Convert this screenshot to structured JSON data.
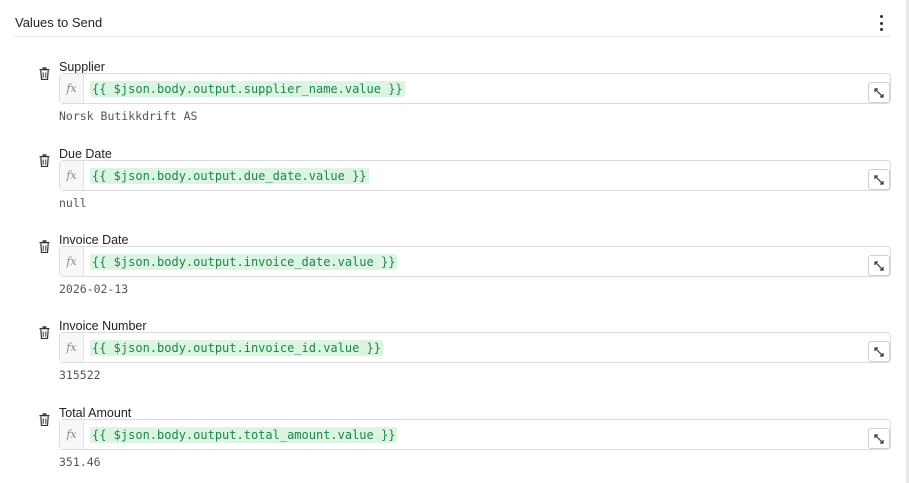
{
  "section": {
    "title": "Values to Send",
    "menu_icon": "kebab-menu-icon"
  },
  "icons": {
    "delete": "trash-icon",
    "expression": "fx-icon",
    "expand": "open-editor-icon"
  },
  "fx_label": "fx",
  "params": [
    {
      "label": "Supplier",
      "expression": "{{ $json.body.output.supplier_name.value }}",
      "preview": "Norsk Butikkdrift AS"
    },
    {
      "label": "Due Date",
      "expression": "{{ $json.body.output.due_date.value }}",
      "preview": "null"
    },
    {
      "label": "Invoice Date",
      "expression": "{{ $json.body.output.invoice_date.value }}",
      "preview": "2026-02-13"
    },
    {
      "label": "Invoice Number",
      "expression": "{{ $json.body.output.invoice_id.value }}",
      "preview": "315522"
    },
    {
      "label": "Total Amount",
      "expression": "{{ $json.body.output.total_amount.value }}",
      "preview": "351.46"
    }
  ]
}
